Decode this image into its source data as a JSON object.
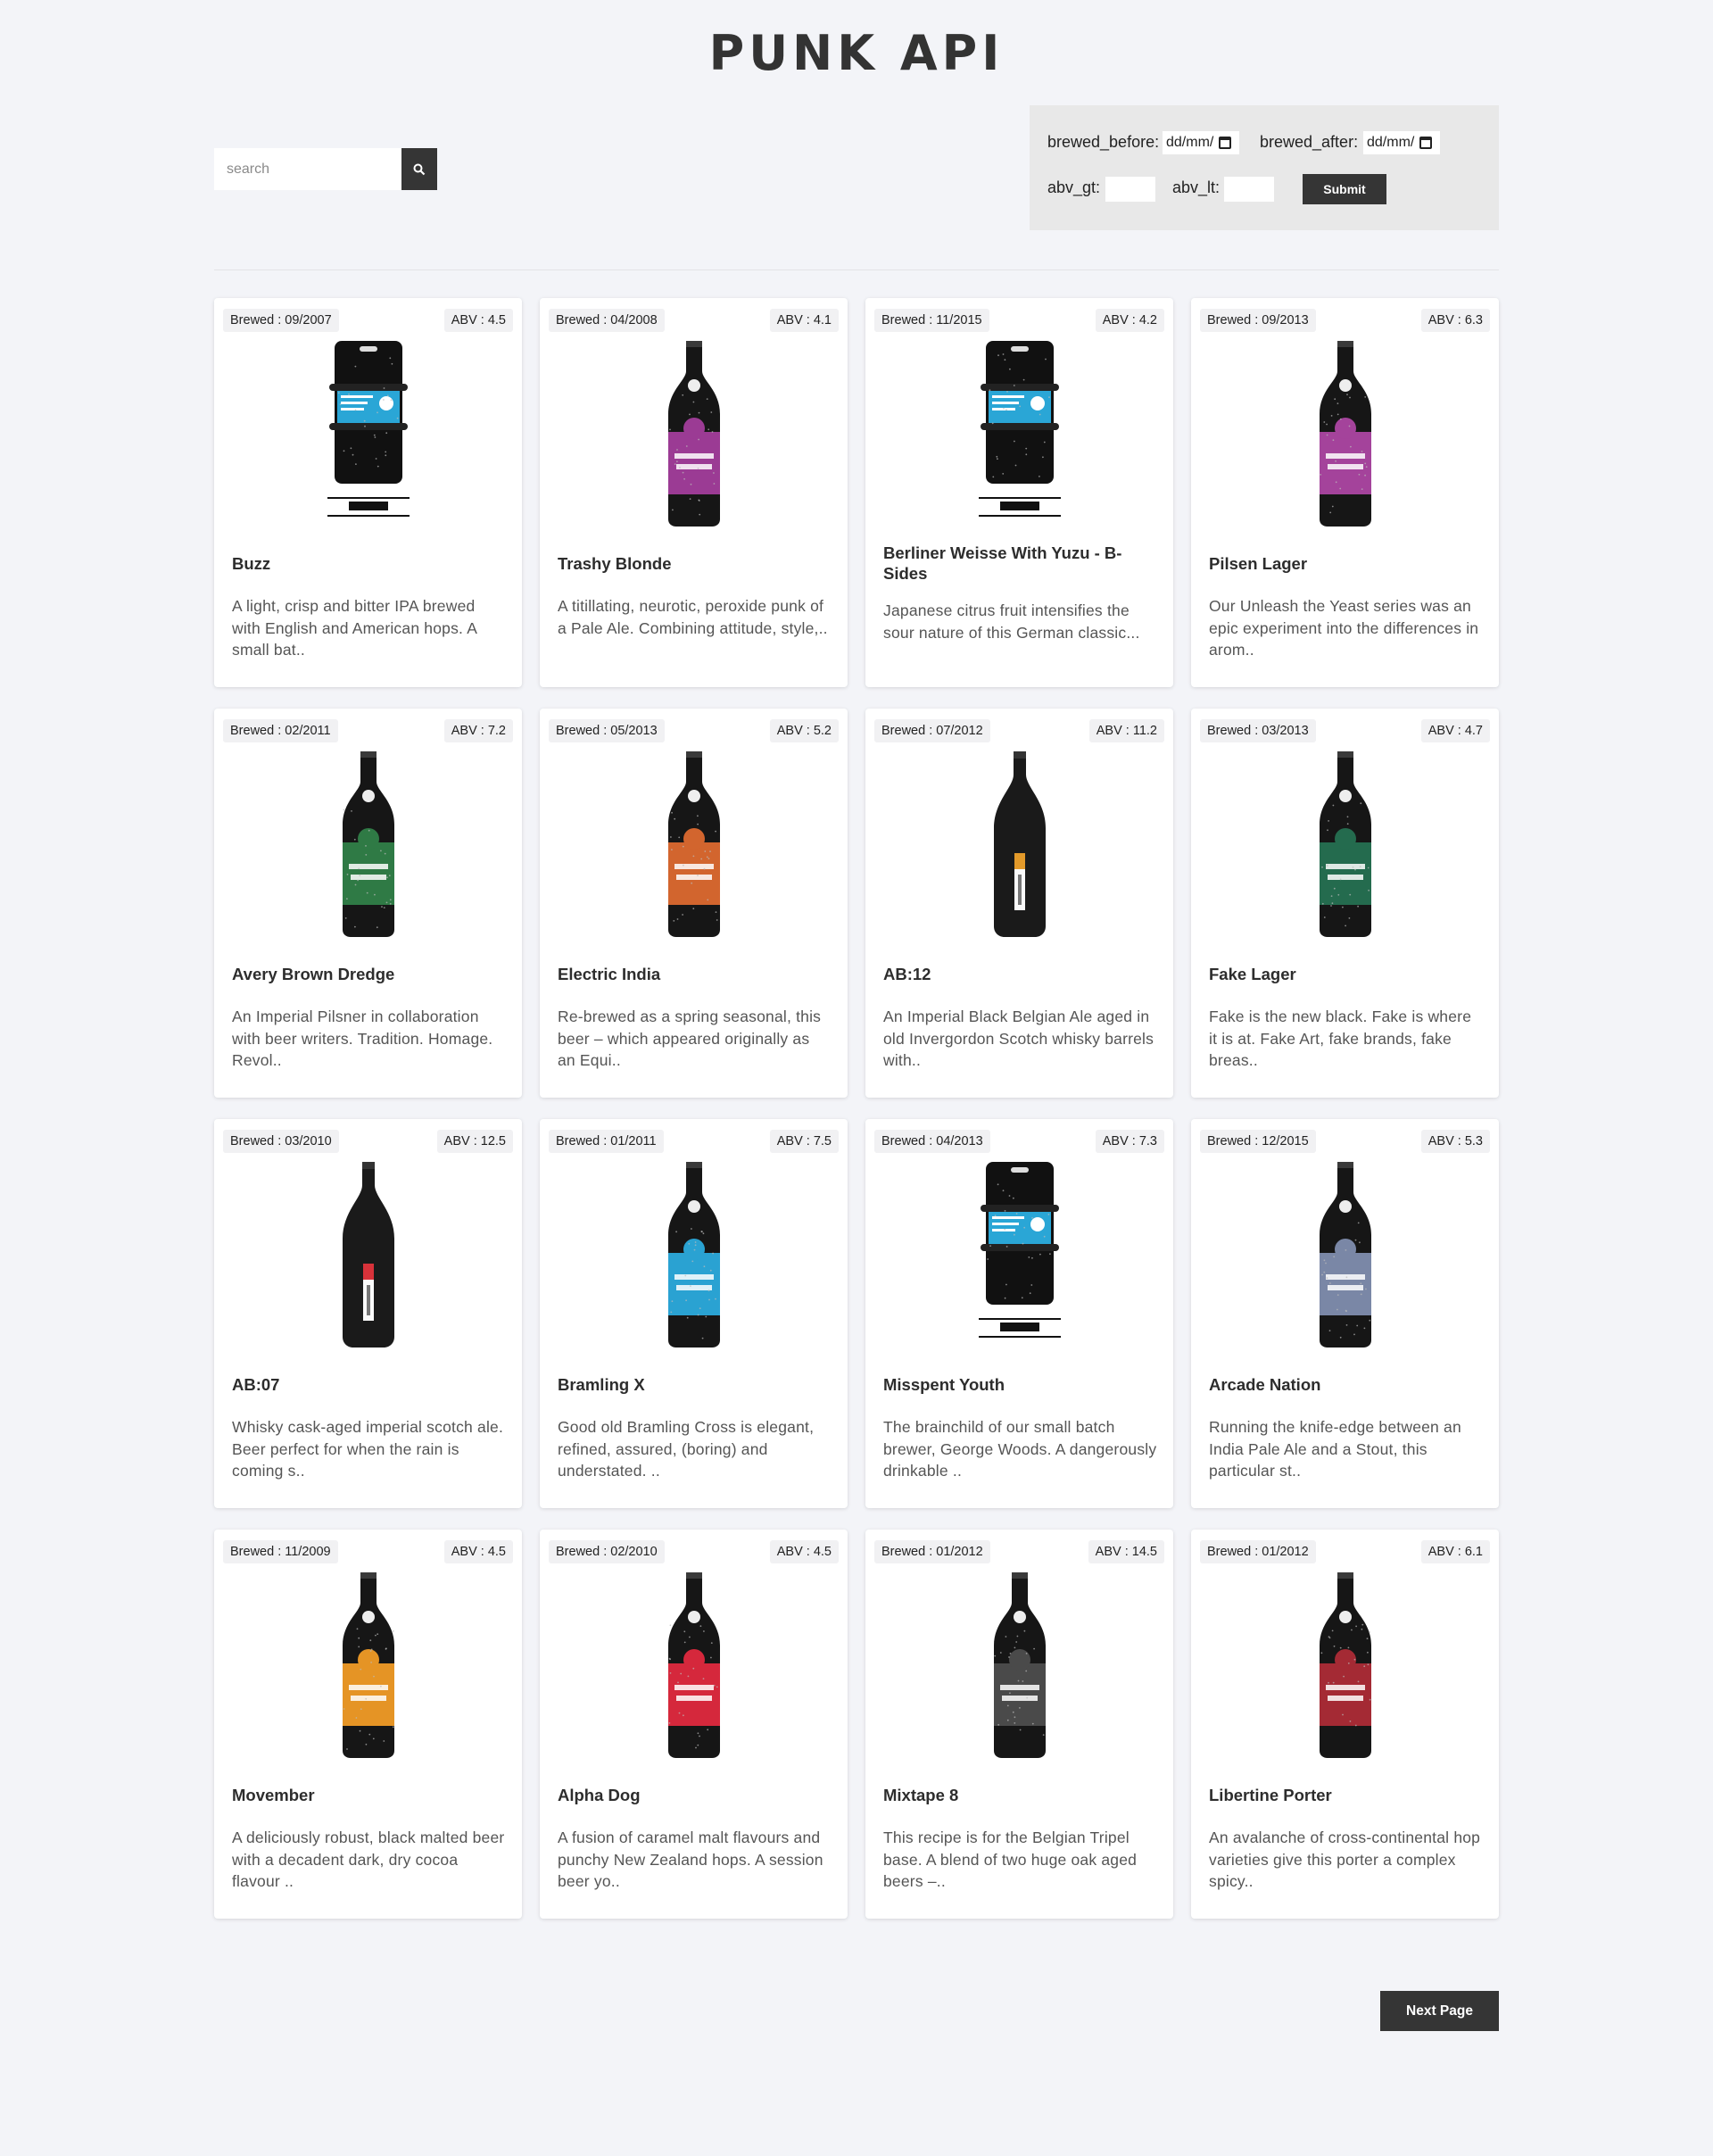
{
  "header": {
    "title": "PUNK API"
  },
  "search": {
    "placeholder": "search",
    "value": ""
  },
  "filters": {
    "brewed_before_label": "brewed_before:",
    "brewed_before_value": "dd/mm/",
    "brewed_after_label": "brewed_after:",
    "brewed_after_value": "dd/mm/",
    "abv_gt_label": "abv_gt:",
    "abv_lt_label": "abv_lt:",
    "submit_label": "Submit"
  },
  "beers": [
    {
      "brewed": "Brewed : 09/2007",
      "abv": "ABV : 4.5",
      "name": "Buzz",
      "desc": "A light, crisp and bitter IPA brewed with English and American hops. A small bat..",
      "image": "keg",
      "label_color": "#2aa6d6"
    },
    {
      "brewed": "Brewed : 04/2008",
      "abv": "ABV : 4.1",
      "name": "Trashy Blonde",
      "desc": "A titillating, neurotic, peroxide punk of a Pale Ale. Combining attitude, style,..",
      "image": "bottle",
      "label_color": "#9b3b94"
    },
    {
      "brewed": "Brewed : 11/2015",
      "abv": "ABV : 4.2",
      "name": "Berliner Weisse With Yuzu - B-Sides",
      "desc": "Japanese citrus fruit intensifies the sour nature of this German classic...",
      "image": "keg",
      "label_color": "#2aa6d6"
    },
    {
      "brewed": "Brewed : 09/2013",
      "abv": "ABV : 6.3",
      "name": "Pilsen Lager",
      "desc": "Our Unleash the Yeast series was an epic experiment into the differences in arom..",
      "image": "bottle",
      "label_color": "#a4439b"
    },
    {
      "brewed": "Brewed : 02/2011",
      "abv": "ABV : 7.2",
      "name": "Avery Brown Dredge",
      "desc": "An Imperial Pilsner in collaboration with beer writers. Tradition. Homage. Revol..",
      "image": "bottle",
      "label_color": "#2f7a45"
    },
    {
      "brewed": "Brewed : 05/2013",
      "abv": "ABV : 5.2",
      "name": "Electric India",
      "desc": "Re-brewed as a spring seasonal, this beer – which appeared originally as an Equi..",
      "image": "bottle",
      "label_color": "#d2652e"
    },
    {
      "brewed": "Brewed : 07/2012",
      "abv": "ABV : 11.2",
      "name": "AB:12",
      "desc": "An Imperial Black Belgian Ale aged in old Invergordon Scotch whisky barrels with..",
      "image": "tall",
      "label_color": "#e39a2a"
    },
    {
      "brewed": "Brewed : 03/2013",
      "abv": "ABV : 4.7",
      "name": "Fake Lager",
      "desc": "Fake is the new black. Fake is where it is at. Fake Art, fake brands, fake breas..",
      "image": "bottle",
      "label_color": "#246b4e"
    },
    {
      "brewed": "Brewed : 03/2010",
      "abv": "ABV : 12.5",
      "name": "AB:07",
      "desc": "Whisky cask-aged imperial scotch ale. Beer perfect for when the rain is coming s..",
      "image": "tall",
      "label_color": "#d8323a"
    },
    {
      "brewed": "Brewed : 01/2011",
      "abv": "ABV : 7.5",
      "name": "Bramling X",
      "desc": "Good old Bramling Cross is elegant, refined, assured, (boring) and understated. ..",
      "image": "bottle",
      "label_color": "#2aa2d2"
    },
    {
      "brewed": "Brewed : 04/2013",
      "abv": "ABV : 7.3",
      "name": "Misspent Youth",
      "desc": "The brainchild of our small batch brewer, George Woods. A dangerously drinkable ..",
      "image": "keg",
      "label_color": "#2aa6d6"
    },
    {
      "brewed": "Brewed : 12/2015",
      "abv": "ABV : 5.3",
      "name": "Arcade Nation",
      "desc": "Running the knife-edge between an India Pale Ale and a Stout, this particular st..",
      "image": "bottle",
      "label_color": "#7a87a6"
    },
    {
      "brewed": "Brewed : 11/2009",
      "abv": "ABV : 4.5",
      "name": "Movember",
      "desc": "A deliciously robust, black malted beer with a decadent dark, dry cocoa flavour ..",
      "image": "bottle",
      "label_color": "#e59425"
    },
    {
      "brewed": "Brewed : 02/2010",
      "abv": "ABV : 4.5",
      "name": "Alpha Dog",
      "desc": "A fusion of caramel malt flavours and punchy New Zealand hops. A session beer yo..",
      "image": "bottle",
      "label_color": "#d5283c"
    },
    {
      "brewed": "Brewed : 01/2012",
      "abv": "ABV : 14.5",
      "name": "Mixtape 8",
      "desc": "This recipe is for the Belgian Tripel base. A blend of two huge oak aged beers –..",
      "image": "bottle",
      "label_color": "#4a4a4a"
    },
    {
      "brewed": "Brewed : 01/2012",
      "abv": "ABV : 6.1",
      "name": "Libertine Porter",
      "desc": "An avalanche of cross-continental hop varieties give this porter a complex spicy..",
      "image": "bottle",
      "label_color": "#a42a34"
    }
  ],
  "pagination": {
    "next_label": "Next Page"
  },
  "icons": {
    "search": "search-icon",
    "calendar": "calendar-icon"
  }
}
